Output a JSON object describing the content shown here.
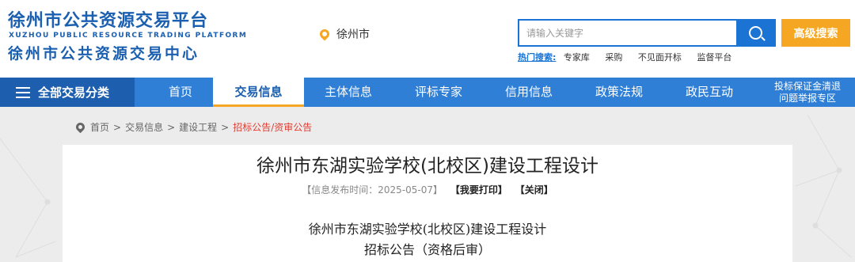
{
  "header": {
    "logo_cn_main": "徐州市公共资源交易平台",
    "logo_en": "XUZHOU PUBLIC RESOURCE TRADING PLATFORM",
    "logo_cn_sub": "徐州市公共资源交易中心",
    "city": "徐州市"
  },
  "search": {
    "placeholder": "请输入关键字",
    "advanced_label": "高级搜索",
    "hot_label": "热门搜索:",
    "hot_items": [
      "专家库",
      "采购",
      "不见面开标",
      "监督平台"
    ]
  },
  "nav": {
    "all_label": "全部交易分类",
    "items": [
      "首页",
      "交易信息",
      "主体信息",
      "评标专家",
      "信用信息",
      "政策法规",
      "政民互动"
    ],
    "active_index": 1,
    "last_line1": "投标保证金清退",
    "last_line2": "问题举报专区"
  },
  "breadcrumb": {
    "items": [
      "首页",
      "交易信息",
      "建设工程",
      "招标公告/资审公告"
    ],
    "separator": ">"
  },
  "article": {
    "title": "徐州市东湖实验学校(北校区)建设工程设计",
    "publish_info": "【信息发布时间：2025-05-07】",
    "print_label": "【我要打印】",
    "close_label": "【关闭】",
    "body_line1": "徐州市东湖实验学校(北校区)建设工程设计",
    "body_line2": "招标公告（资格后审）"
  },
  "colors": {
    "brand_blue": "#1b5fb0",
    "nav_blue": "#2f7fd6",
    "accent_orange": "#f5a623",
    "breadcrumb_current": "#e03c31"
  }
}
